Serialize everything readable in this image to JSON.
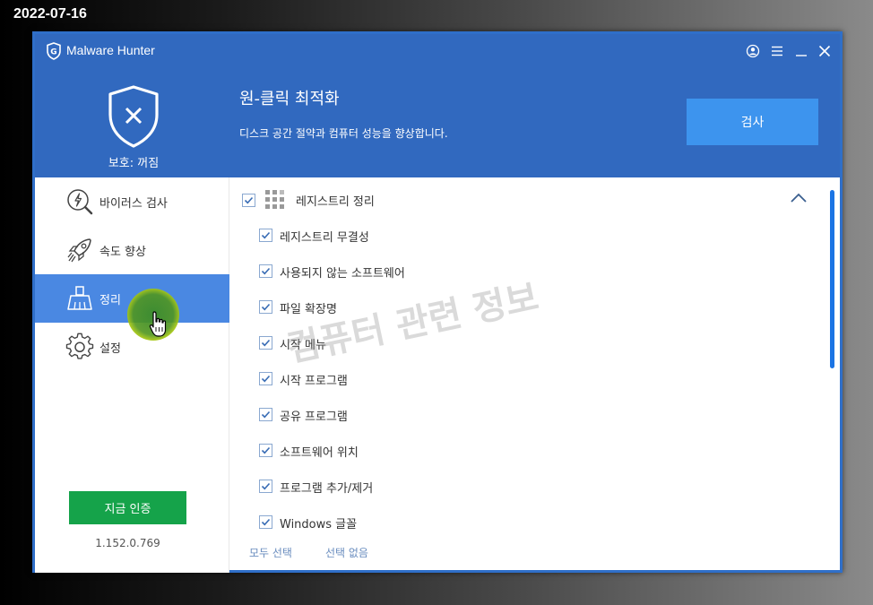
{
  "date_stamp": "2022-07-16",
  "window": {
    "title": "Malware Hunter"
  },
  "header": {
    "protection_status": "보호: 꺼짐",
    "headline": "원-클릭 최적화",
    "subline": "디스크 공간 절약과 컴퓨터 성능을 향상합니다.",
    "scan_button": "검사"
  },
  "sidebar": {
    "items": [
      {
        "label": "바이러스 검사",
        "icon": "virus-scan-icon",
        "active": false
      },
      {
        "label": "속도 향상",
        "icon": "rocket-icon",
        "active": false
      },
      {
        "label": "정리",
        "icon": "broom-icon",
        "active": true
      },
      {
        "label": "설정",
        "icon": "gear-icon",
        "active": false
      }
    ],
    "activate_button": "지금 인증",
    "version": "1.152.0.769"
  },
  "content": {
    "section_title": "레지스트리 정리",
    "section_checked": true,
    "items": [
      {
        "label": "레지스트리 무결성",
        "checked": true
      },
      {
        "label": "사용되지 않는 소프트웨어",
        "checked": true
      },
      {
        "label": "파일 확장명",
        "checked": true
      },
      {
        "label": "시작 메뉴",
        "checked": true
      },
      {
        "label": "시작 프로그램",
        "checked": true
      },
      {
        "label": "공유 프로그램",
        "checked": true
      },
      {
        "label": "소프트웨어 위치",
        "checked": true
      },
      {
        "label": "프로그램 추가/제거",
        "checked": true
      },
      {
        "label": "Windows 글꼴",
        "checked": true
      }
    ],
    "select_all": "모두 선택",
    "select_none": "선택 없음",
    "watermark": "컴퓨터 관련 정보"
  },
  "colors": {
    "header_blue": "#3169bf",
    "active_blue": "#4a88e2",
    "scan_button": "#3d94ee",
    "activate_green": "#15a34a"
  }
}
